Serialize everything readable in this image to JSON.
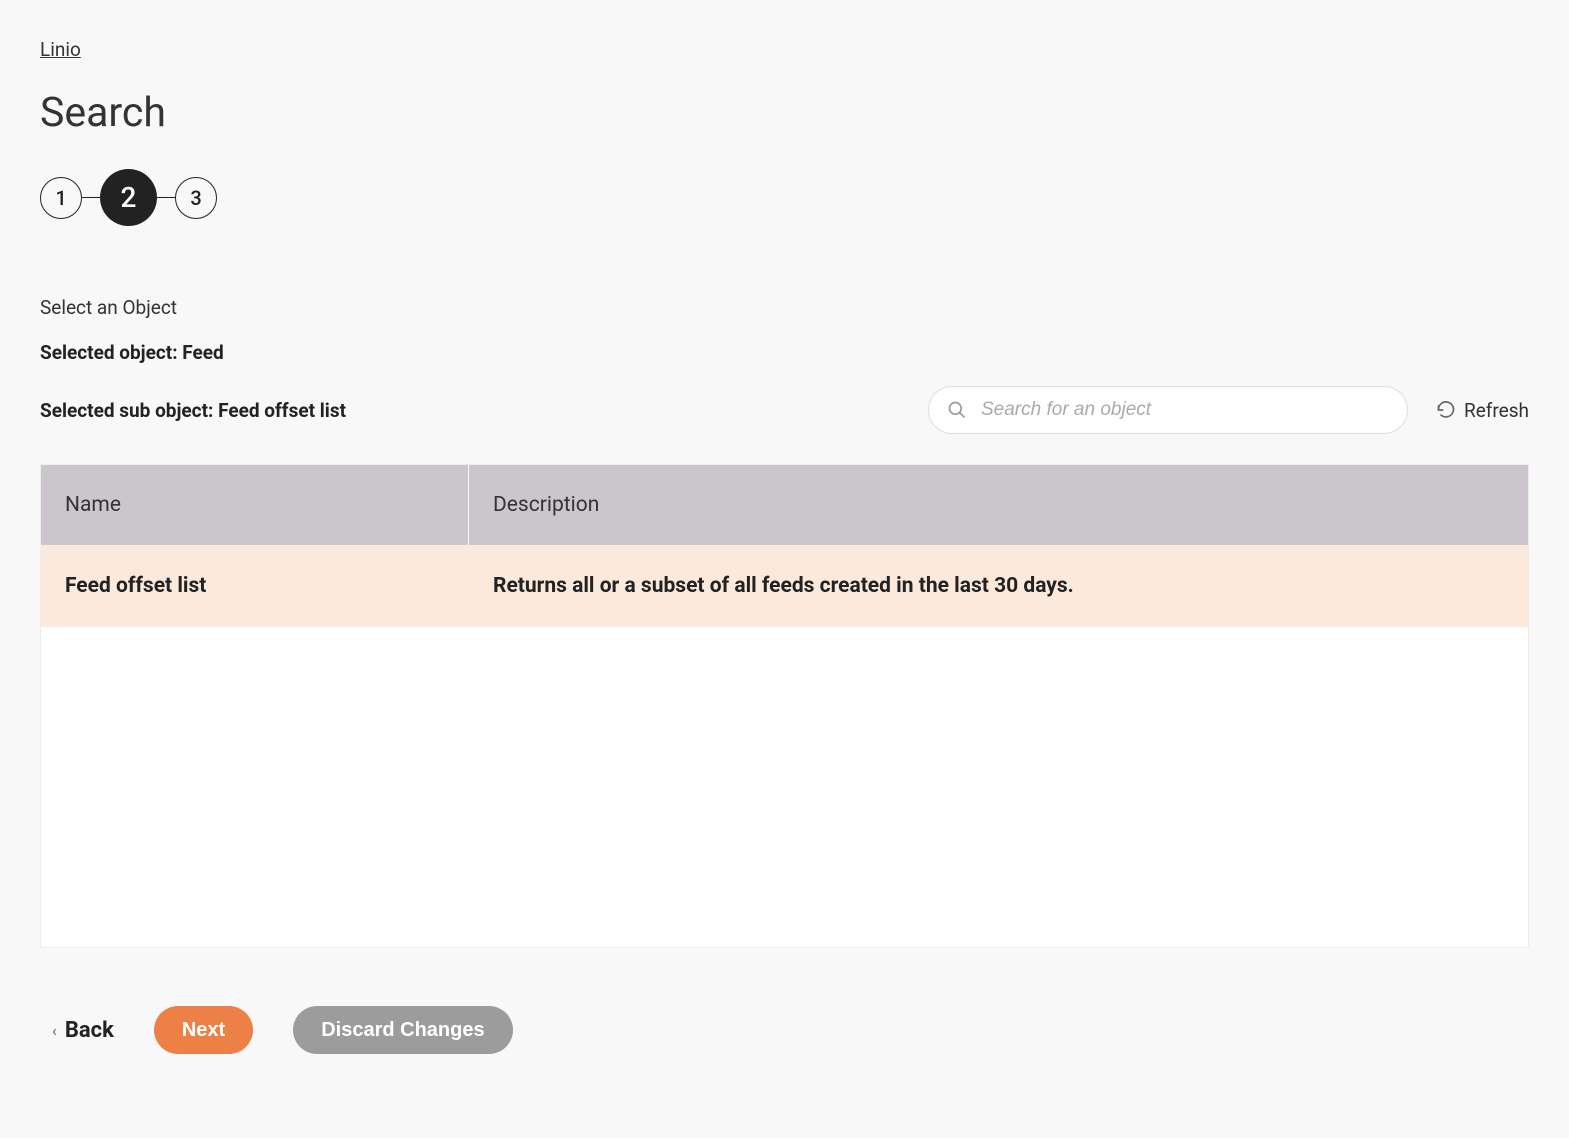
{
  "breadcrumb": {
    "link": "Linio"
  },
  "page_title": "Search",
  "stepper": {
    "steps": [
      "1",
      "2",
      "3"
    ],
    "active_index": 1
  },
  "section": {
    "label": "Select an Object",
    "selected_object_prefix": "Selected object: ",
    "selected_object_value": "Feed",
    "selected_sub_object_prefix": "Selected sub object: ",
    "selected_sub_object_value": "Feed offset list"
  },
  "search": {
    "placeholder": "Search for an object"
  },
  "refresh_label": "Refresh",
  "table": {
    "columns": [
      "Name",
      "Description"
    ],
    "rows": [
      {
        "name": "Feed offset list",
        "description": "Returns all or a subset of all feeds created in the last 30 days."
      }
    ]
  },
  "actions": {
    "back": "Back",
    "next": "Next",
    "discard": "Discard Changes"
  },
  "colors": {
    "accent": "#ed8047",
    "step_active_bg": "#222222",
    "table_header_bg": "#cbc6cc",
    "row_selected_bg": "#fbe9dc",
    "discard_bg": "#9d9c9d"
  }
}
